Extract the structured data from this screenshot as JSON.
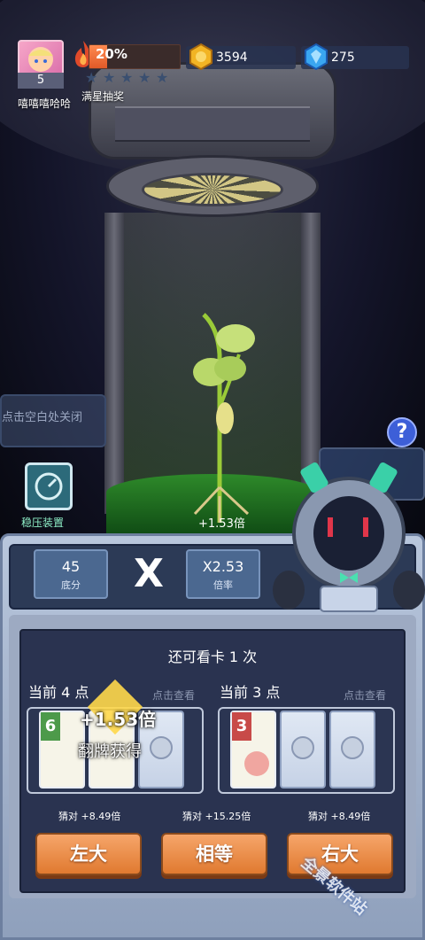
{
  "player": {
    "level": "5",
    "name": "嘻嘻嘻哈哈"
  },
  "star_progress": {
    "percent_text": "20%",
    "fill_fraction": 0.2,
    "stars_total": 5,
    "caption": "满星抽奖"
  },
  "resources": {
    "gold": "3594",
    "gems": "275"
  },
  "scene": {
    "close_hint": "点击空白处关闭",
    "stabilizer_label": "稳压装置",
    "plant_multiplier": "+1.53倍"
  },
  "help": {
    "label": "?"
  },
  "score": {
    "base_value": "45",
    "base_label": "底分",
    "x_sign": "X",
    "mult_value": "X2.53",
    "mult_label": "倍率"
  },
  "round": {
    "remaining": "还可看卡 1 次"
  },
  "left_group": {
    "points": "当前 4 点",
    "view_hint": "点击查看",
    "card1": "6",
    "bonus": "+1.53倍",
    "bonus_note": "翻牌获得"
  },
  "right_group": {
    "points": "当前 3 点",
    "view_hint": "点击查看",
    "card1": "3"
  },
  "guesses": {
    "left": "猜对 +8.49倍",
    "middle": "猜对 +15.25倍",
    "right": "猜对 +8.49倍"
  },
  "buttons": {
    "left": "左大",
    "equal": "相等",
    "right": "右大"
  },
  "watermark": "全景软件站",
  "colors": {
    "button": "#e07a30",
    "panel": "#8fa0bc",
    "card_green": "#4d9a4a",
    "card_red": "#c84a48"
  }
}
